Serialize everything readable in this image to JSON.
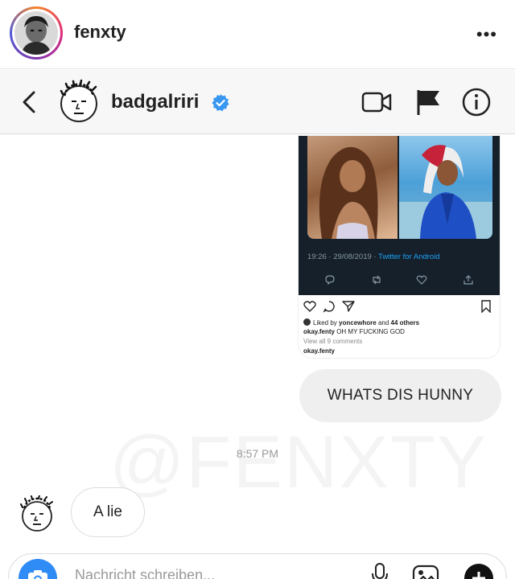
{
  "profile": {
    "username": "fenxty",
    "more_label": "•••"
  },
  "conversation": {
    "name": "badgalriri",
    "verified": true
  },
  "shared_post": {
    "tweet_meta": "19:26 · 29/08/2019 · ",
    "tweet_source": "Twitter for Android",
    "liked_prefix": "Liked by ",
    "liked_user": "yoncewhore",
    "liked_suffix": " and ",
    "liked_others": "44 others",
    "caption_user": "okay.fenty",
    "caption_text": " OH MY FUCKING GOD",
    "view_comments": "View all 9 comments",
    "comment_user": "okay.fenty"
  },
  "messages": {
    "outgoing": "WHATS DIS HUNNY",
    "timestamp": "8:57 PM",
    "incoming": "A lie"
  },
  "watermark": "@FENXTY",
  "composer": {
    "placeholder": "Nachricht schreiben..."
  },
  "colors": {
    "accent_blue": "#2f8bf5",
    "verified_blue": "#3897f0",
    "twitter_blue": "#1da1f2",
    "tweet_bg": "#15202b"
  }
}
